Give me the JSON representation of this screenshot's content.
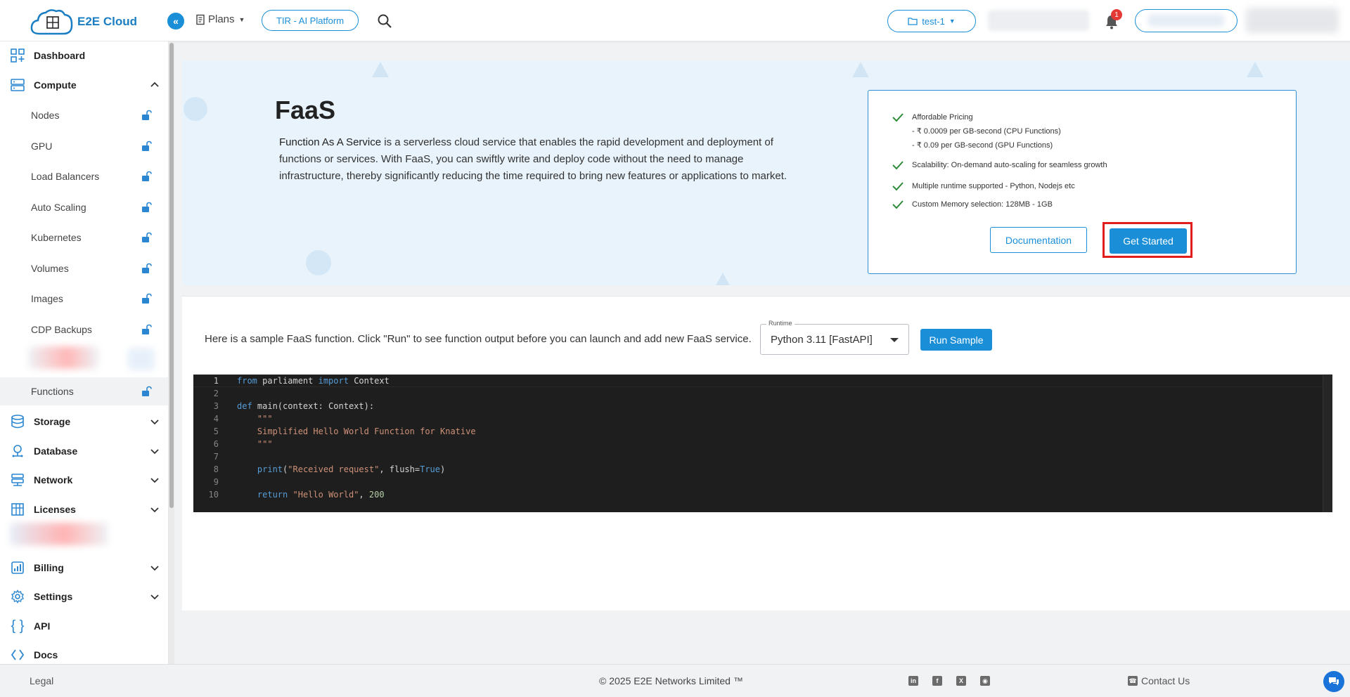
{
  "header": {
    "logo_text": "E2E Cloud",
    "plans_label": "Plans",
    "tir_button": "TIR - AI Platform",
    "project_button": "test-1",
    "notification_count": "1"
  },
  "sidebar": {
    "items": [
      {
        "label": "Dashboard",
        "icon": "dashboard-icon"
      },
      {
        "label": "Compute",
        "icon": "compute-icon"
      },
      {
        "label": "Nodes"
      },
      {
        "label": "GPU"
      },
      {
        "label": "Load Balancers"
      },
      {
        "label": "Auto Scaling"
      },
      {
        "label": "Kubernetes"
      },
      {
        "label": "Volumes"
      },
      {
        "label": "Images"
      },
      {
        "label": "CDP Backups"
      },
      {
        "label": "Functions"
      },
      {
        "label": "Storage",
        "icon": "storage-icon"
      },
      {
        "label": "Database",
        "icon": "database-icon"
      },
      {
        "label": "Network",
        "icon": "network-icon"
      },
      {
        "label": "Licenses",
        "icon": "licenses-icon"
      },
      {
        "label": "Billing",
        "icon": "billing-icon"
      },
      {
        "label": "Settings",
        "icon": "settings-icon"
      },
      {
        "label": "API",
        "icon": "api-icon"
      },
      {
        "label": "Docs",
        "icon": "docs-icon"
      }
    ]
  },
  "banner": {
    "title": "FaaS",
    "desc_bold": "Function As A Service",
    "desc_rest": " is a serverless cloud service that enables the rapid development and deployment of functions or services. With FaaS, you can swiftly write and deploy code without the need to manage infrastructure, thereby significantly reducing the time required to bring new features or applications to market.",
    "features": [
      {
        "line1": "Affordable Pricing",
        "line2": "- ₹ 0.0009 per GB-second (CPU Functions)",
        "line3": "- ₹ 0.09 per GB-second (GPU Functions)"
      },
      {
        "line1": "Scalability: On-demand auto-scaling for seamless growth"
      },
      {
        "line1": "Multiple runtime supported - Python, Nodejs etc"
      },
      {
        "line1": "Custom Memory selection: 128MB - 1GB"
      }
    ],
    "documentation_button": "Documentation",
    "get_started_button": "Get Started"
  },
  "sample": {
    "text": "Here is a sample FaaS function. Click \"Run\" to see function output before you can launch and add new FaaS service.",
    "runtime_label": "Runtime",
    "runtime_value": "Python 3.11 [FastAPI]",
    "run_button": "Run Sample"
  },
  "editor": {
    "line_numbers": [
      "1",
      "2",
      "3",
      "4",
      "5",
      "6",
      "7",
      "8",
      "9",
      "10"
    ]
  },
  "footer": {
    "legal": "Legal",
    "copyright": "© 2025 E2E Networks Limited ™",
    "contact": "Contact Us"
  },
  "colors": {
    "accent": "#1a8fd8",
    "highlight": "#e11d1d"
  }
}
